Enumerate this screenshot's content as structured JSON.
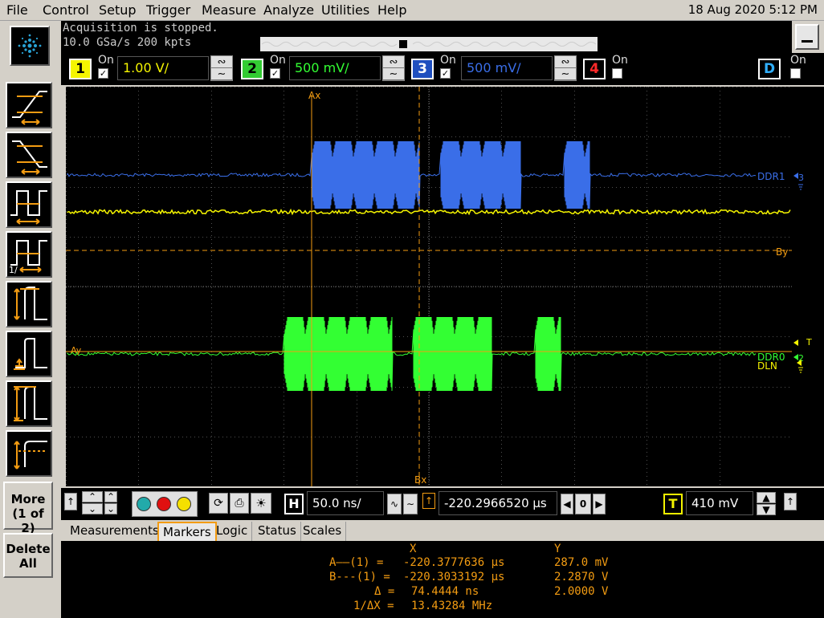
{
  "menu": {
    "items": [
      "File",
      "Control",
      "Setup",
      "Trigger",
      "Measure",
      "Analyze",
      "Utilities",
      "Help"
    ],
    "datetime": "18 Aug 2020  5:12 PM"
  },
  "status": {
    "line1": "Acquisition is stopped.",
    "line2": "10.0 GSa/s   200 kpts"
  },
  "channels": [
    {
      "num": "1",
      "on_label": "On",
      "checked": true,
      "scale": "1.00 V/",
      "color": "#f5f500"
    },
    {
      "num": "2",
      "on_label": "On",
      "checked": true,
      "scale": "500 mV/",
      "color": "#33ff33"
    },
    {
      "num": "3",
      "on_label": "On",
      "checked": true,
      "scale": "500 mV/",
      "color": "#3a6ee8"
    },
    {
      "num": "4",
      "on_label": "On",
      "checked": false,
      "scale": "",
      "color": "#ff2a2a"
    },
    {
      "num": "D",
      "on_label": "On",
      "checked": false,
      "scale": "",
      "color": "#31b0ff"
    }
  ],
  "waveform_labels": {
    "ax": "Ax",
    "bx": "Bx",
    "by": "By",
    "ay": "Ay",
    "ddr1": "DDR1",
    "ddr0": "DDR0",
    "dln": "DLN",
    "trig_marker": "T"
  },
  "sidebar": {
    "more_label": "More",
    "more_page": "(1 of 2)",
    "delete_label": "Delete",
    "delete_sub": "All"
  },
  "controls": {
    "horizontal_label": "H",
    "timebase": "50.0 ns/",
    "position": "-220.2966520 µs",
    "zero": "0",
    "trigger_label": "T",
    "trigger_level": "410 mV"
  },
  "tabs": [
    "Measurements",
    "Markers",
    "Logic",
    "Status",
    "Scales"
  ],
  "active_tab": "Markers",
  "markers": {
    "col_x": "X",
    "col_y": "Y",
    "rows": [
      {
        "label": "A——(1) =",
        "x": "-220.3777636 µs",
        "y": "287.0 mV"
      },
      {
        "label": "B---(1) =",
        "x": "-220.3033192 µs",
        "y": "2.2870 V"
      },
      {
        "label": "Δ =",
        "x": "74.4444 ns",
        "y": "2.0000 V"
      },
      {
        "label": "1/ΔX =",
        "x": "13.43284 MHz",
        "y": ""
      }
    ]
  },
  "colors": {
    "ch1": "#f5f500",
    "ch2": "#33ff33",
    "ch3": "#3a6ee8",
    "marker": "#f39c12",
    "grid": "#505050"
  }
}
